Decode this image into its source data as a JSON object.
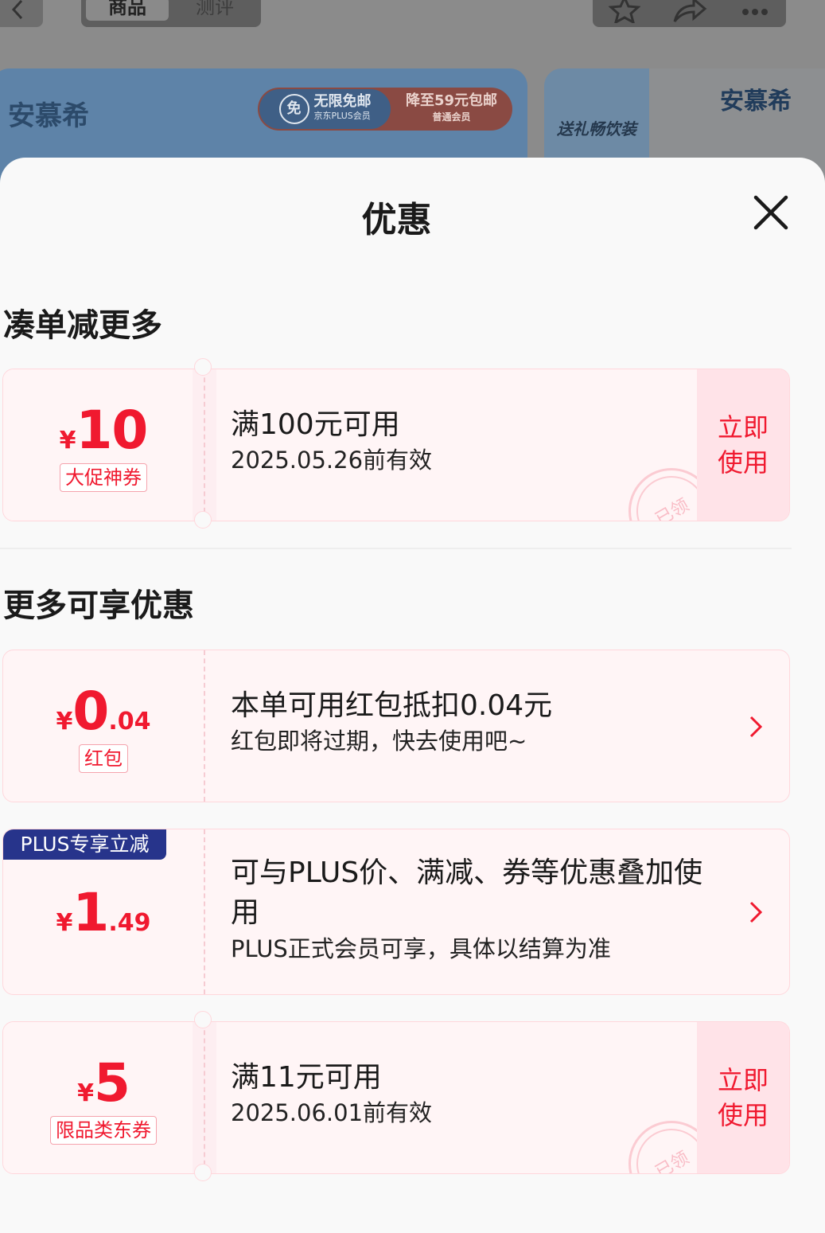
{
  "background": {
    "tabs": [
      "商品",
      "测评"
    ],
    "banner1": {
      "brand": "安慕希",
      "badge_main": "无限免邮",
      "badge_sub": "京东PLUS会员",
      "badge_right": "降至59元包邮",
      "badge_right_sub": "普通会员",
      "badge_icon": "免"
    },
    "banner2": {
      "brand": "安慕希",
      "slogan": "送礼畅饮装"
    }
  },
  "sheet": {
    "title": "优惠",
    "sections": {
      "combine": "凑单减更多",
      "more": "更多可享优惠"
    },
    "coupons": [
      {
        "yen": "¥",
        "amount": "10",
        "decimal": "",
        "tag": "大促神券",
        "line1": "满100元可用",
        "line2": "2025.05.26前有效",
        "action": "立即\n使用",
        "stamp": "已领"
      },
      {
        "yen": "¥",
        "amount": "0",
        "decimal": ".04",
        "tag": "红包",
        "line1": "本单可用红包抵扣0.04元",
        "line2": "红包即将过期，快去使用吧~"
      },
      {
        "badge": "PLUS专享立减",
        "yen": "¥",
        "amount": "1",
        "decimal": ".49",
        "line1": "可与PLUS价、满减、券等优惠叠加使用",
        "line2": "PLUS正式会员可享，具体以结算为准"
      },
      {
        "yen": "¥",
        "amount": "5",
        "decimal": "",
        "tag": "限品类东券",
        "line1": "满11元可用",
        "line2": "2025.06.01前有效",
        "action": "立即\n使用",
        "stamp": "已领"
      }
    ]
  },
  "colors": {
    "accent_red": "#f0192f",
    "coupon_bg": "#fff5f6",
    "plus_blue": "#27348b"
  }
}
